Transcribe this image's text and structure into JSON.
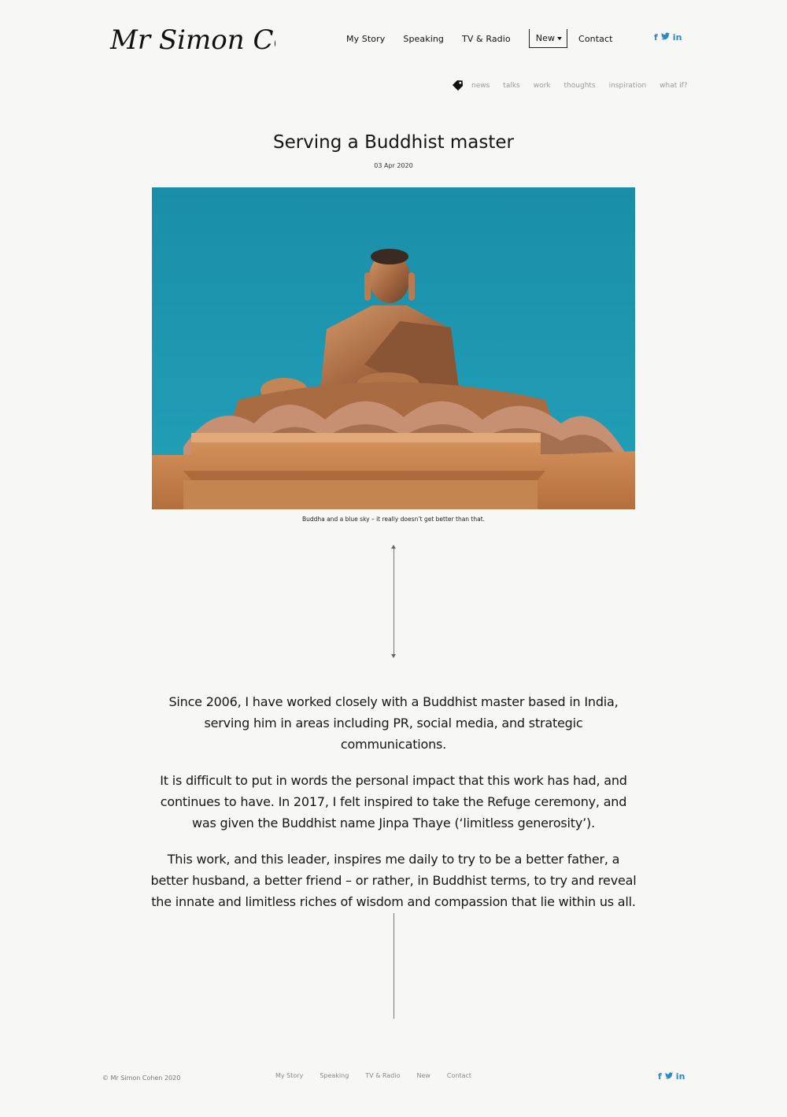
{
  "site": {
    "logo_text": "Mr Simon Cohen"
  },
  "nav": {
    "items": [
      "My Story",
      "Speaking",
      "TV & Radio"
    ],
    "dropdown_label": "New",
    "contact": "Contact"
  },
  "social": {
    "facebook": "f",
    "twitter": "t",
    "linkedin": "in",
    "color": "#2b8ac4"
  },
  "tags": [
    "news",
    "talks",
    "work",
    "thoughts",
    "inspiration",
    "what if?"
  ],
  "article": {
    "title": "Serving a Buddhist master",
    "date": "03 Apr 2020",
    "image_caption": "Buddha and a blue sky – it really doesn’t get better than that.",
    "paragraphs": [
      "Since 2006, I have worked closely with a Buddhist master based in India, serving him in areas including PR, social media, and strategic communications.",
      "It is difficult to put in words the personal impact that this work has had, and continues to have. In 2017, I felt inspired to take the Refuge ceremony, and was given the Buddhist name Jinpa Thaye (‘limitless generosity’).",
      "This work, and this leader, inspires me daily to try to be a better father, a better husband, a better friend – or rather, in Buddhist terms, to try and reveal the innate and limitless riches of wisdom and compassion that lie within us all."
    ]
  },
  "footer": {
    "copyright": "© Mr Simon Cohen 2020",
    "links": [
      "My Story",
      "Speaking",
      "TV & Radio",
      "New",
      "Contact"
    ]
  }
}
